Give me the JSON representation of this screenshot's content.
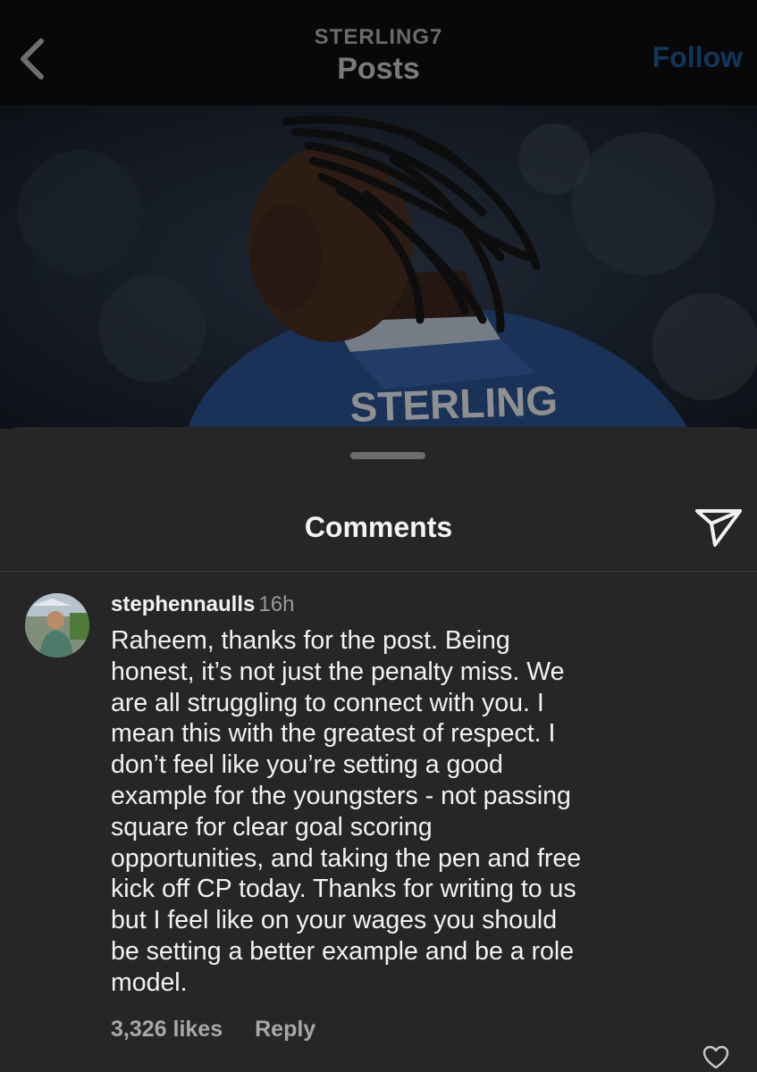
{
  "header": {
    "account": "STERLING7",
    "title": "Posts",
    "follow_label": "Follow",
    "back_icon": "chevron-left-icon"
  },
  "post": {
    "jersey_text": "STERLING"
  },
  "comments_sheet": {
    "title": "Comments",
    "share_icon": "send-icon"
  },
  "comment": {
    "username": "stephennaulls",
    "timestamp": "16h",
    "text": "Raheem, thanks for the post. Being\nhonest, it’s not just the penalty miss. We\nare all struggling to connect with you. I\nmean this with the greatest of respect.  I\ndon’t feel like you’re setting a good\nexample for the youngsters - not passing\nsquare for clear goal scoring\nopportunities, and taking the pen and free\nkick off CP today. Thanks for writing to us\nbut I feel like on your wages you should\nbe setting a better example and be a role\nmodel.",
    "likes": "3,326 likes",
    "reply_label": "Reply",
    "like_icon": "heart-icon"
  },
  "colors": {
    "background": "#262626",
    "header_background": "#080808",
    "follow_accent": "#12365a",
    "jersey_blue": "#2a4f8f"
  }
}
